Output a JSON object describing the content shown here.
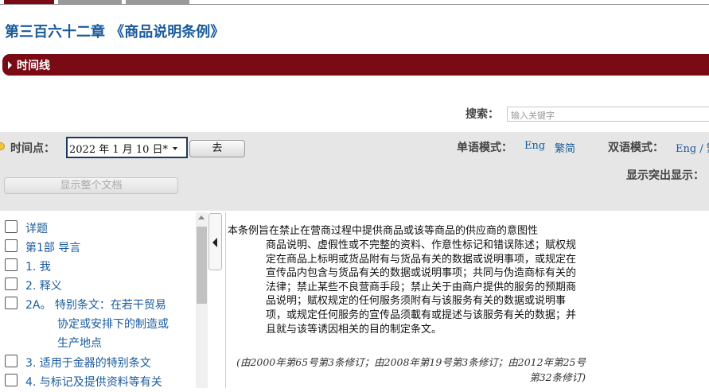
{
  "colors": {
    "brand_red": "#7a0a14",
    "link_blue": "#1a5a9c",
    "tab_active": "#7a0a14",
    "tab_inactive": "#9a9a9a"
  },
  "chapter": {
    "title": "第三百六十二章 《商品说明条例》"
  },
  "timeline": {
    "label": "时间线",
    "icon": "triangle-right-icon"
  },
  "search": {
    "label": "搜索：",
    "placeholder": "输入关键字"
  },
  "toolbar": {
    "timepoint_label": "时间点：",
    "date_value": "2022 年 1 月 10 日*",
    "go_label": "去",
    "monolingual_label": "单语模式：",
    "mono_eng": "Eng",
    "mono_trad": "繁简",
    "bilingual_label": "双语模式：",
    "bi_link": "Eng / 繁",
    "highlight_label": "显示突出显示：",
    "full_doc_label": "显示整个文档"
  },
  "toc": {
    "items": [
      {
        "label": "详题"
      },
      {
        "label": "第1部 导言"
      },
      {
        "label": "1. 我"
      },
      {
        "label": "2. 释义"
      },
      {
        "label_lines": [
          "2A。 特别条文：在若干贸易",
          "协定或安排下的制造或",
          "生产地点"
        ]
      },
      {
        "label": "3. 适用于金器的特别条文"
      },
      {
        "label": "4. 与标记及提供资料等有关"
      }
    ]
  },
  "content": {
    "first_line": "本条例旨在禁止在营商过程中提供商品或该等商品的供应商的意图性",
    "body": "商品说明、虚假性或不完整的资料、作意性标记和错误陈述；赋权规定在商品上标明或货品附有与货品有关的数据或说明事项，或规定在宣传品内包含与货品有关的数据或说明事项；共同与伪造商标有关的法律；禁止某些不良营商手段；禁止关于由商户提供的服务的预期商品说明；赋权规定的任何服务须附有与该服务有关的数据或说明事项，或规定任何服务的宣传品须載有或提述与该服务有关的数据；并且就与该等诱因相关的目的制定条文。",
    "amendment_note": "(由2000年第65号第3条修订；由2008年第19号第3条修订；由2012年第25号第32条修订)"
  }
}
